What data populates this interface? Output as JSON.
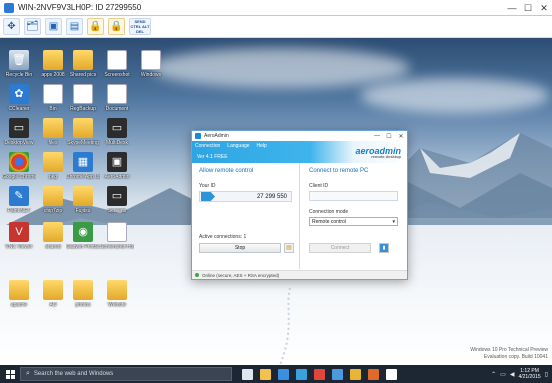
{
  "session": {
    "title": "WIN-2NVF9V3LH0P: ID 27299550",
    "minimize": "—",
    "maximize": "☐",
    "close": "✕",
    "toolbar": [
      {
        "icon": "remote-control-icon",
        "glyph": "✥"
      },
      {
        "icon": "file-manager-icon",
        "glyph": "🗂"
      },
      {
        "icon": "screen-icon",
        "glyph": "▣"
      },
      {
        "icon": "screen-icon-2",
        "glyph": "▤"
      },
      {
        "icon": "lock-icon",
        "glyph": "🔒"
      },
      {
        "icon": "lock-icon-2",
        "glyph": "🔒"
      },
      {
        "icon": "send-keys-icon",
        "glyph": "SEND CTRL ALT DEL"
      }
    ]
  },
  "desktop": {
    "icons": [
      {
        "label": "Recycle Bin",
        "glyph": "🗑",
        "style": "g-bin"
      },
      {
        "label": "apps 2008",
        "glyph": "",
        "style": "g-folder"
      },
      {
        "label": "Shared pics",
        "glyph": "",
        "style": "g-folder"
      },
      {
        "label": "Screenshot",
        "glyph": "",
        "style": "g-doc"
      },
      {
        "label": "Windows",
        "glyph": "",
        "style": "g-doc"
      },
      {
        "label": "CCleaner",
        "glyph": "✿",
        "style": "g-app"
      },
      {
        "label": "Bin",
        "glyph": "",
        "style": "g-doc"
      },
      {
        "label": "RegBackup",
        "glyph": "",
        "style": "g-doc"
      },
      {
        "label": "Document",
        "glyph": "",
        "style": "g-doc"
      },
      {
        "label": "DesktopView",
        "glyph": "▭",
        "style": "g-dark"
      },
      {
        "label": "files",
        "glyph": "",
        "style": "g-folder"
      },
      {
        "label": "SkypeMeeting",
        "glyph": "",
        "style": "g-folder"
      },
      {
        "label": "MultiDesk",
        "glyph": "▭",
        "style": "g-dark"
      },
      {
        "label": "Google Chrome",
        "glyph": "",
        "style": "g-chrome"
      },
      {
        "label": "pkg",
        "glyph": "",
        "style": "g-folder"
      },
      {
        "label": "Chrome App Launcher",
        "glyph": "▦",
        "style": "g-app"
      },
      {
        "label": "AeroAdmin",
        "glyph": "▣",
        "style": "g-dark"
      },
      {
        "label": "Paint.NET",
        "glyph": "✎",
        "style": "g-app"
      },
      {
        "label": "chip7zip",
        "glyph": "",
        "style": "g-folder"
      },
      {
        "label": "Fujitsu",
        "glyph": "",
        "style": "g-folder"
      },
      {
        "label": "Screens",
        "glyph": "▭",
        "style": "g-dark"
      },
      {
        "label": "VNC Viewer",
        "glyph": "V",
        "style": "g-red"
      },
      {
        "label": "shared",
        "glyph": "",
        "style": "g-folder"
      },
      {
        "label": "Gadwin PrintScreen",
        "glyph": "◉",
        "style": "g-green"
      },
      {
        "label": "Screenshot Hosting",
        "glyph": "▤",
        "style": "g-doc"
      },
      {
        "label": "apache",
        "glyph": "",
        "style": "g-folder"
      },
      {
        "label": "AO",
        "glyph": "",
        "style": "g-folder"
      },
      {
        "label": "photos",
        "glyph": "",
        "style": "g-folder"
      },
      {
        "label": "Website",
        "glyph": "",
        "style": "g-folder"
      }
    ],
    "watermark": [
      "Windows 10 Pro Technical Preview",
      "Evaluation copy. Build 10041"
    ]
  },
  "aeroadmin": {
    "title": "AeroAdmin",
    "menu": [
      "Connection",
      "Language",
      "Help"
    ],
    "version": "Ver 4.1 FREE",
    "logo": "aeroadmin",
    "logo_sub": "remote desktop",
    "allow": {
      "heading": "Allow remote control",
      "id_label": "Your ID",
      "id_value": "27 299 550",
      "active_connections": "Active connections: 1",
      "stop_label": "Stop"
    },
    "connect": {
      "heading": "Connect to remote PC",
      "client_id_label": "Client ID",
      "client_id_value": "",
      "mode_label": "Connection mode",
      "mode_value": "Remote control",
      "connect_label": "Connect"
    },
    "status": "Online (secure, AES + RSA encrypted)"
  },
  "taskbar": {
    "search_placeholder": "Search the web and Windows",
    "apps": [
      {
        "icon": "task-view-icon",
        "color": "#dfe6ee"
      },
      {
        "icon": "explorer-icon",
        "color": "#f2c14e"
      },
      {
        "icon": "ie-icon",
        "color": "#3a8fe0"
      },
      {
        "icon": "store-icon",
        "color": "#3aa0e0"
      },
      {
        "icon": "chrome-icon",
        "color": "#e0463a"
      },
      {
        "icon": "paint-icon",
        "color": "#4a9ae0"
      },
      {
        "icon": "folder-icon",
        "color": "#e8b534"
      },
      {
        "icon": "media-icon",
        "color": "#e06a2a"
      },
      {
        "icon": "aeroadmin-icon",
        "color": "#ffffff"
      }
    ],
    "clock_time": "1:12 PM",
    "clock_date": "4/21/2015"
  }
}
